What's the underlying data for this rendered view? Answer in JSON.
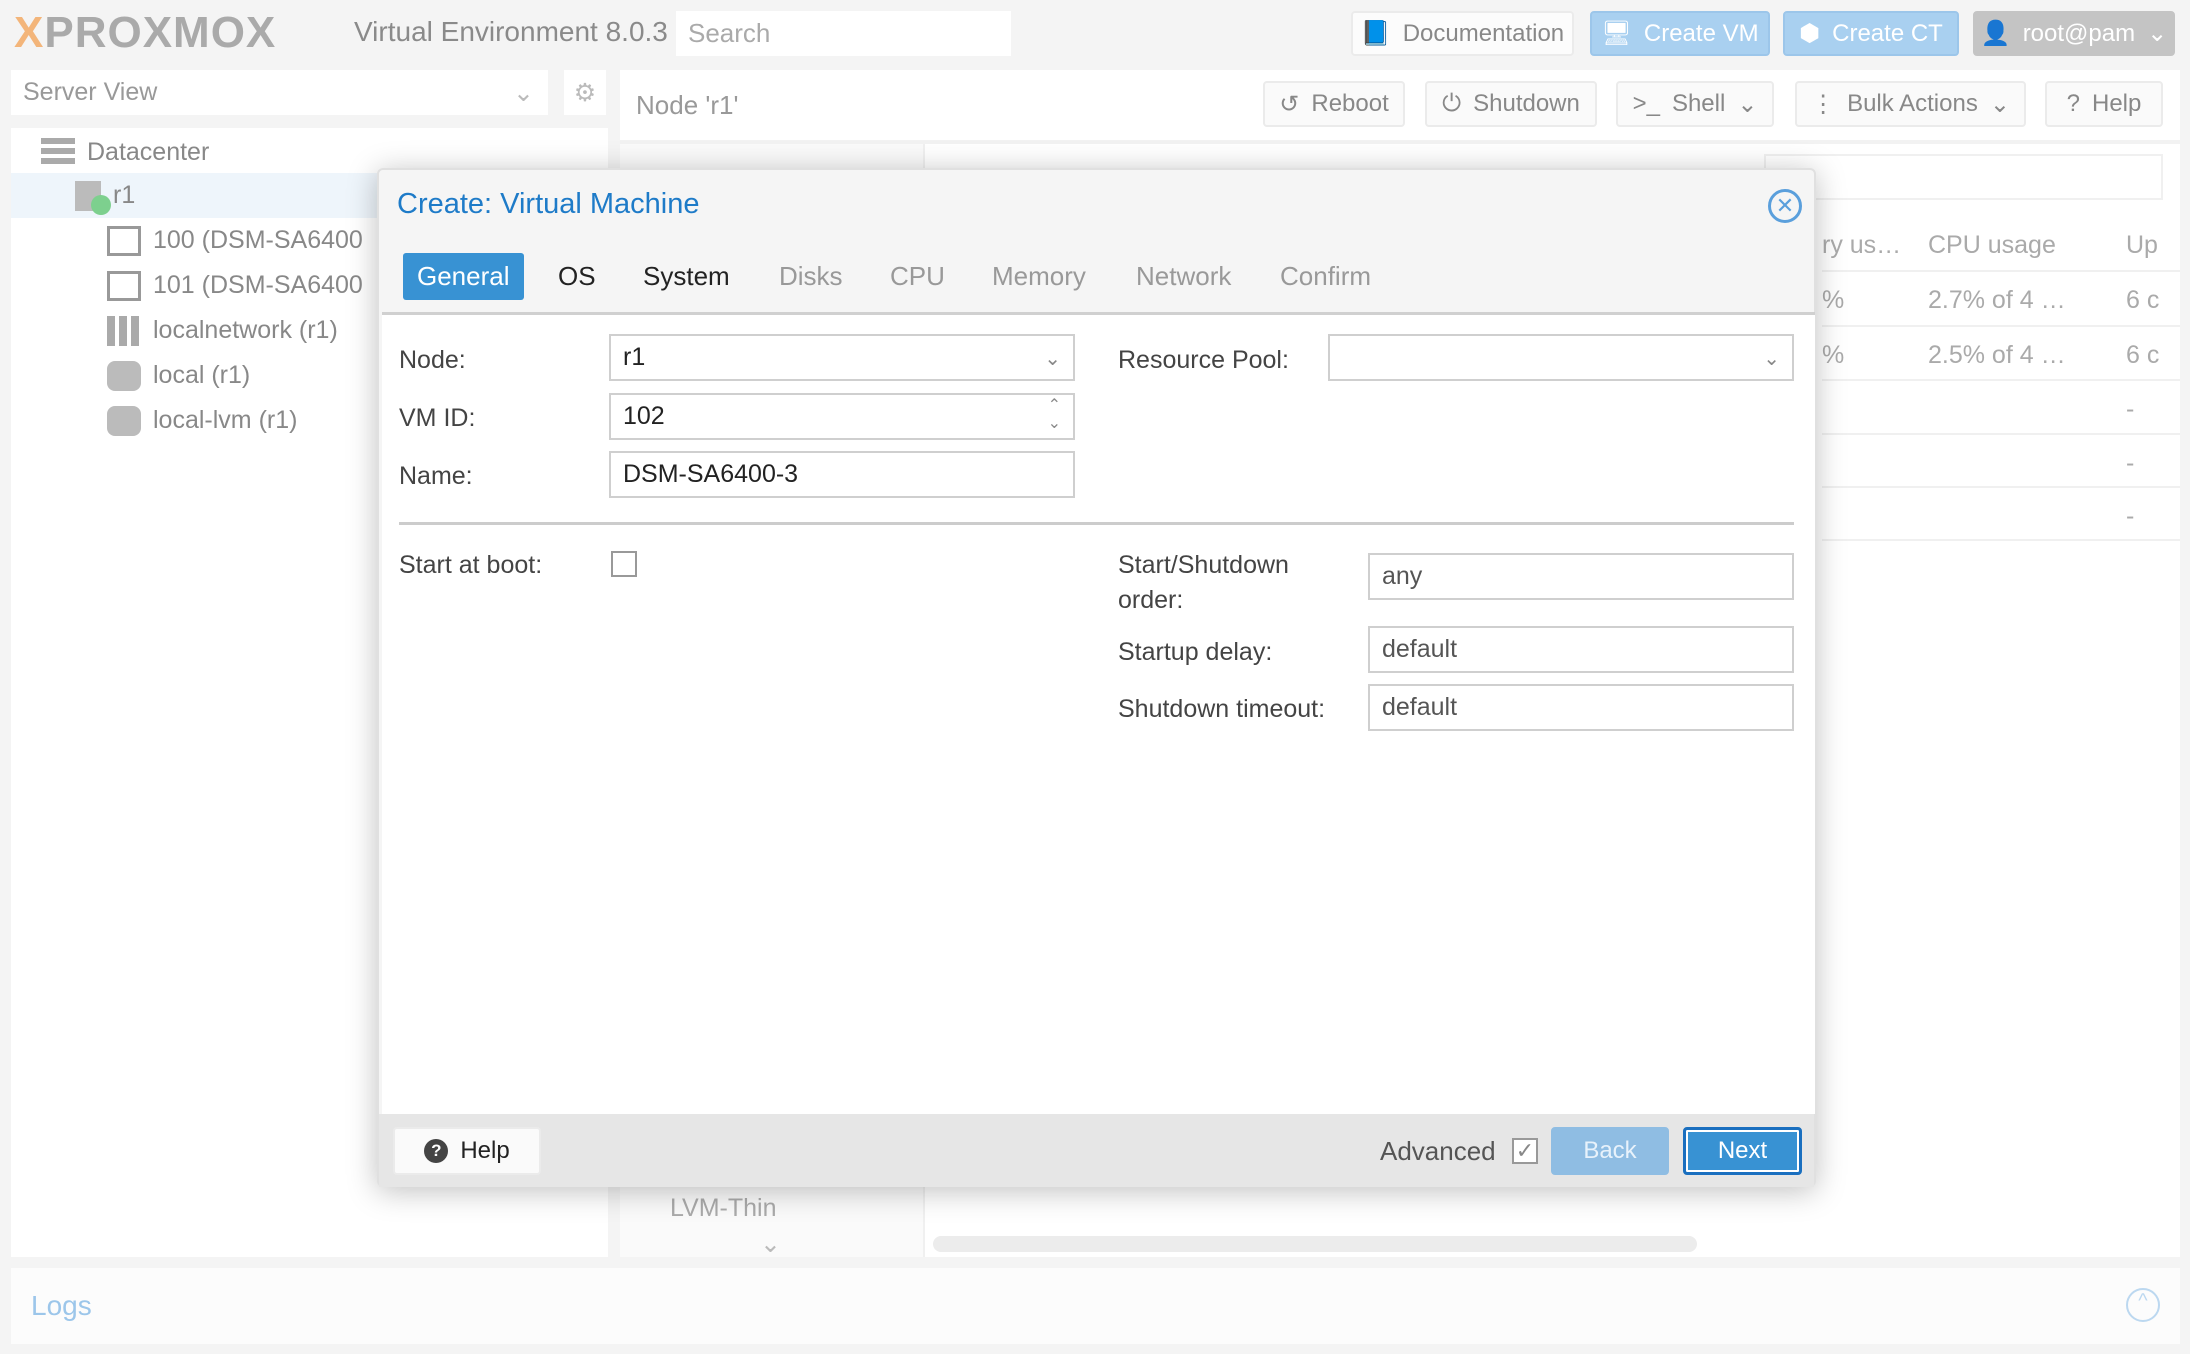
{
  "header": {
    "brand": "PROXMOX",
    "version": "Virtual Environment 8.0.3",
    "search_placeholder": "Search",
    "documentation": "Documentation",
    "create_vm": "Create VM",
    "create_ct": "Create CT",
    "user": "root@pam"
  },
  "sidebar": {
    "view": "Server View",
    "tree": [
      {
        "label": "Datacenter"
      },
      {
        "label": "r1"
      },
      {
        "label": "100 (DSM-SA6400"
      },
      {
        "label": "101 (DSM-SA6400"
      },
      {
        "label": "localnetwork (r1)"
      },
      {
        "label": "local (r1)"
      },
      {
        "label": "local-lvm (r1)"
      }
    ]
  },
  "content": {
    "title": "Node 'r1'",
    "buttons": {
      "reboot": "Reboot",
      "shutdown": "Shutdown",
      "shell": "Shell",
      "bulk": "Bulk Actions",
      "help": "Help"
    },
    "grid": {
      "headers": [
        "ry us…",
        "CPU usage",
        "Up"
      ],
      "rows": [
        [
          "%",
          "2.7% of 4 …",
          "6 c"
        ],
        [
          "%",
          "2.5% of 4 …",
          "6 c"
        ],
        [
          "",
          "",
          "-"
        ],
        [
          "",
          "",
          "-"
        ],
        [
          "",
          "",
          "-"
        ]
      ]
    },
    "nav_partial": "LVM-Thin"
  },
  "logs": {
    "title": "Logs"
  },
  "dialog": {
    "title": "Create: Virtual Machine",
    "tabs": [
      "General",
      "OS",
      "System",
      "Disks",
      "CPU",
      "Memory",
      "Network",
      "Confirm"
    ],
    "active_tab": "General",
    "fields": {
      "node_label": "Node:",
      "node": "r1",
      "resource_pool_label": "Resource Pool:",
      "resource_pool": "",
      "vmid_label": "VM ID:",
      "vmid": "102",
      "name_label": "Name:",
      "name": "DSM-SA6400-3",
      "start_at_boot_label": "Start at boot:",
      "start_at_boot": false,
      "order_label_1": "Start/Shutdown",
      "order_label_2": "order:",
      "order": "any",
      "startup_delay_label": "Startup delay:",
      "startup_delay": "default",
      "shutdown_timeout_label": "Shutdown timeout:",
      "shutdown_timeout": "default"
    },
    "footer": {
      "help": "Help",
      "advanced": "Advanced",
      "advanced_checked": true,
      "back": "Back",
      "next": "Next"
    }
  },
  "colors": {
    "accent": "#3892d3",
    "title": "#1e7bc8"
  }
}
